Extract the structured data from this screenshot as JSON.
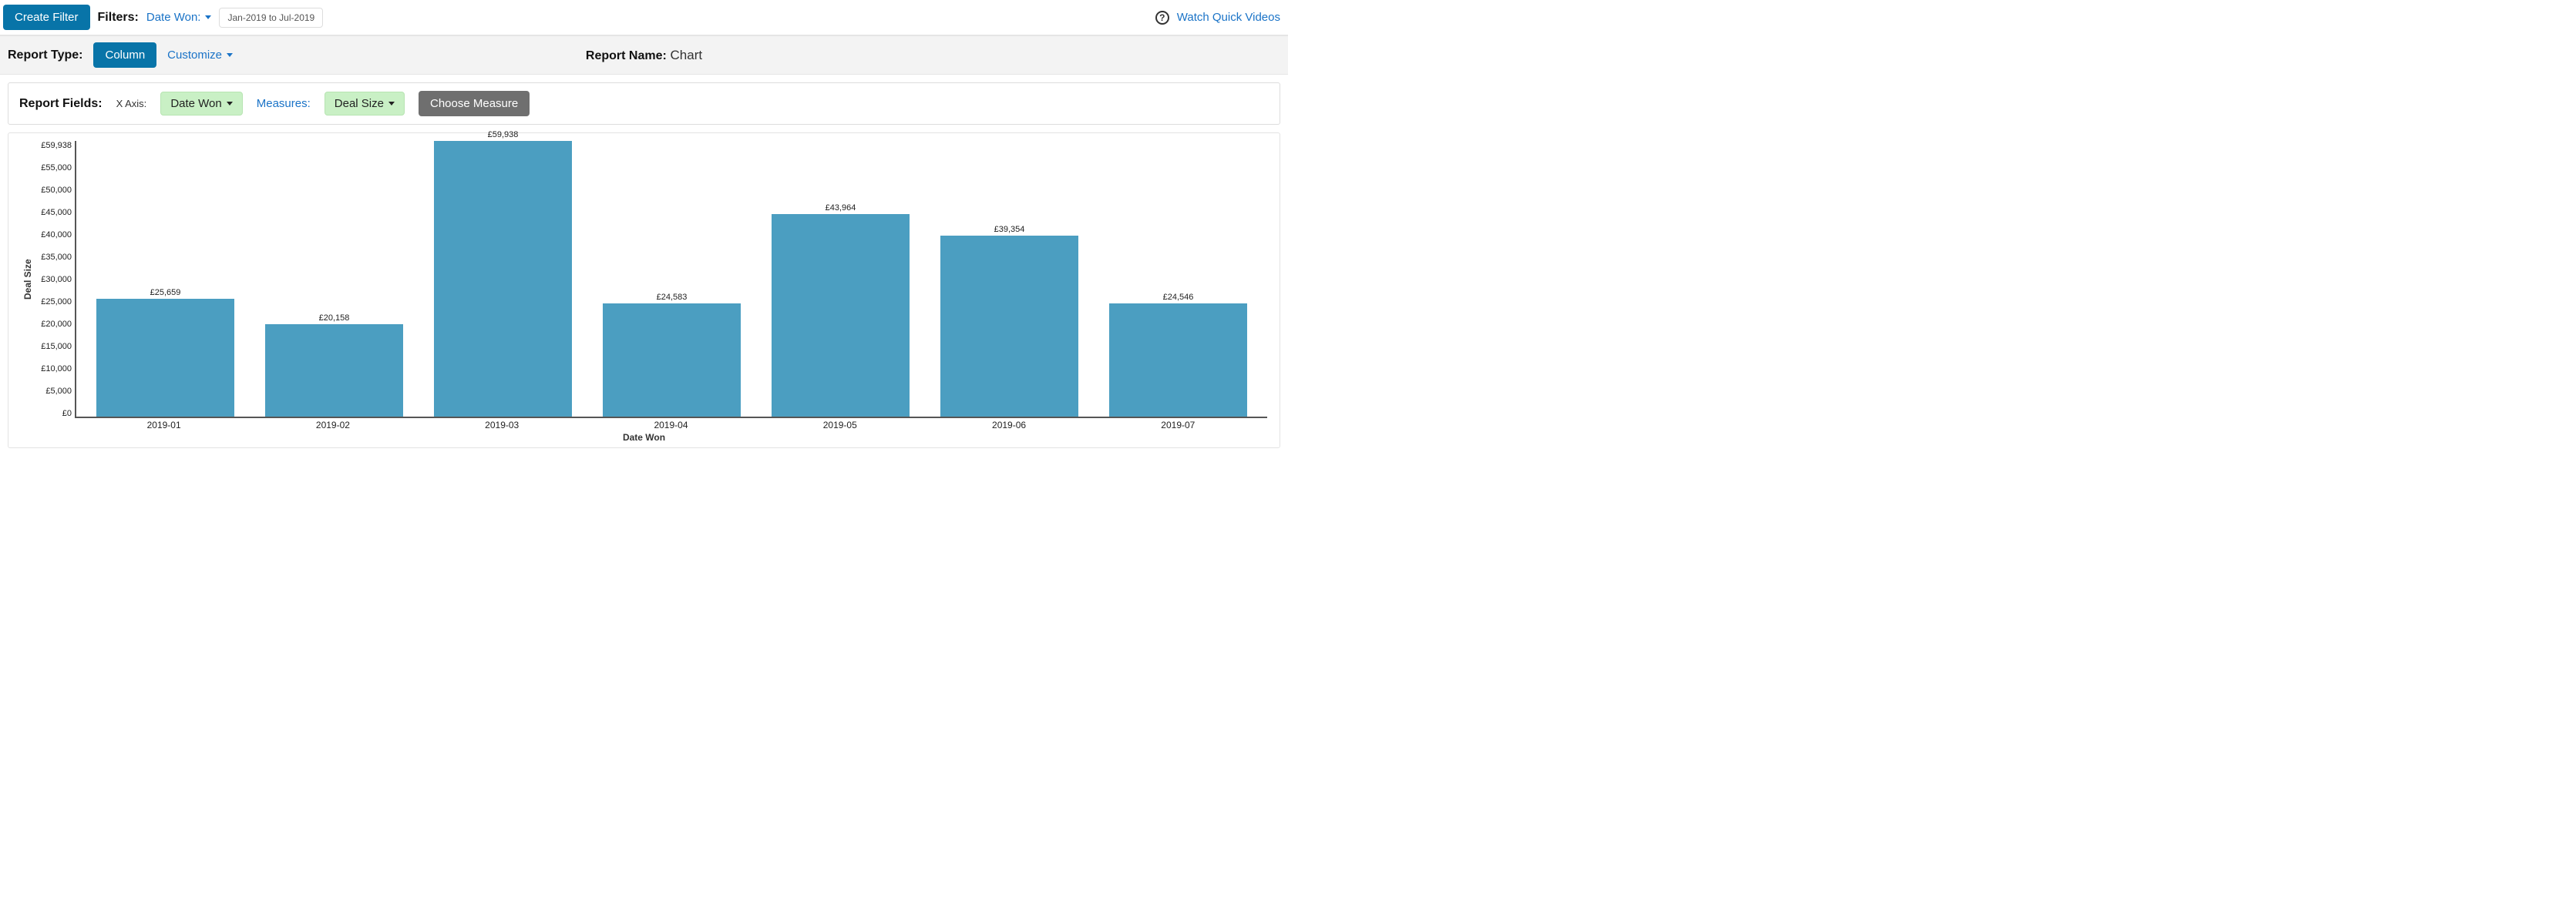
{
  "topbar": {
    "create_filter": "Create Filter",
    "filters_label": "Filters:",
    "filter_field": "Date Won:",
    "filter_range": "Jan-2019 to Jul-2019",
    "help_link": "Watch Quick Videos"
  },
  "reportbar": {
    "type_label": "Report Type:",
    "type_value": "Column",
    "customize": "Customize",
    "name_label": "Report Name:",
    "name_value": "Chart"
  },
  "fields": {
    "label": "Report Fields:",
    "xaxis_label": "X Axis:",
    "xaxis_value": "Date Won",
    "measures_label": "Measures:",
    "measure_value": "Deal Size",
    "choose_measure": "Choose Measure"
  },
  "chart_data": {
    "type": "bar",
    "title": "",
    "xlabel": "Date Won",
    "ylabel": "Deal Size",
    "ylim": [
      0,
      59938
    ],
    "ytick_labels": [
      "£59,938",
      "£55,000",
      "£50,000",
      "£45,000",
      "£40,000",
      "£35,000",
      "£30,000",
      "£25,000",
      "£20,000",
      "£15,000",
      "£10,000",
      "£5,000",
      "£0"
    ],
    "categories": [
      "2019-01",
      "2019-02",
      "2019-03",
      "2019-04",
      "2019-05",
      "2019-06",
      "2019-07"
    ],
    "values": [
      25659,
      20158,
      59938,
      24583,
      43964,
      39354,
      24546
    ],
    "value_labels": [
      "£25,659",
      "£20,158",
      "£59,938",
      "£24,583",
      "£43,964",
      "£39,354",
      "£24,546"
    ],
    "currency": "GBP"
  }
}
